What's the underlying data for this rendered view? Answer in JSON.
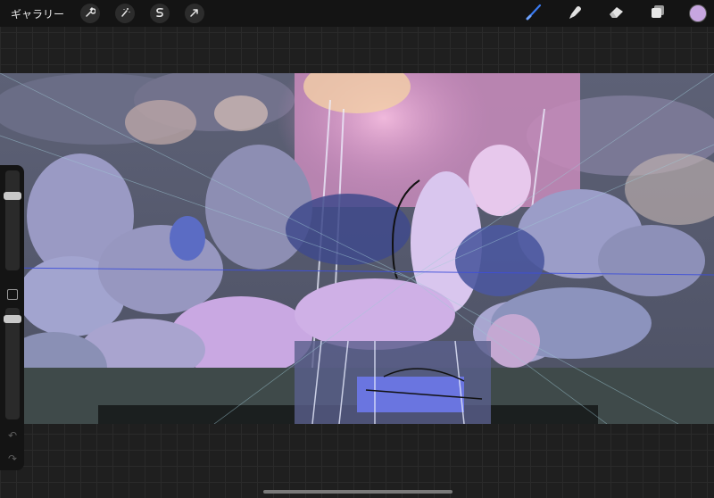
{
  "toolbar": {
    "gallery_label": "ギャラリー",
    "left_tools": [
      {
        "name": "actions",
        "icon": "wrench-icon"
      },
      {
        "name": "adjustments",
        "icon": "magic-wand-icon"
      },
      {
        "name": "selection",
        "icon": "selection-s-icon"
      },
      {
        "name": "transform",
        "icon": "arrow-cursor-icon"
      }
    ],
    "right_tools": [
      {
        "name": "brush",
        "icon": "brush-icon",
        "active": true,
        "color": "#3a7bf2"
      },
      {
        "name": "smudge",
        "icon": "smudge-icon"
      },
      {
        "name": "eraser",
        "icon": "eraser-icon"
      },
      {
        "name": "layers",
        "icon": "layers-icon"
      }
    ],
    "current_color": "#c7a6e0"
  },
  "sidebar": {
    "brush_size_level": 0.77,
    "opacity_level": 0.93,
    "undo_icon": "undo-icon",
    "redo_icon": "redo-icon"
  }
}
